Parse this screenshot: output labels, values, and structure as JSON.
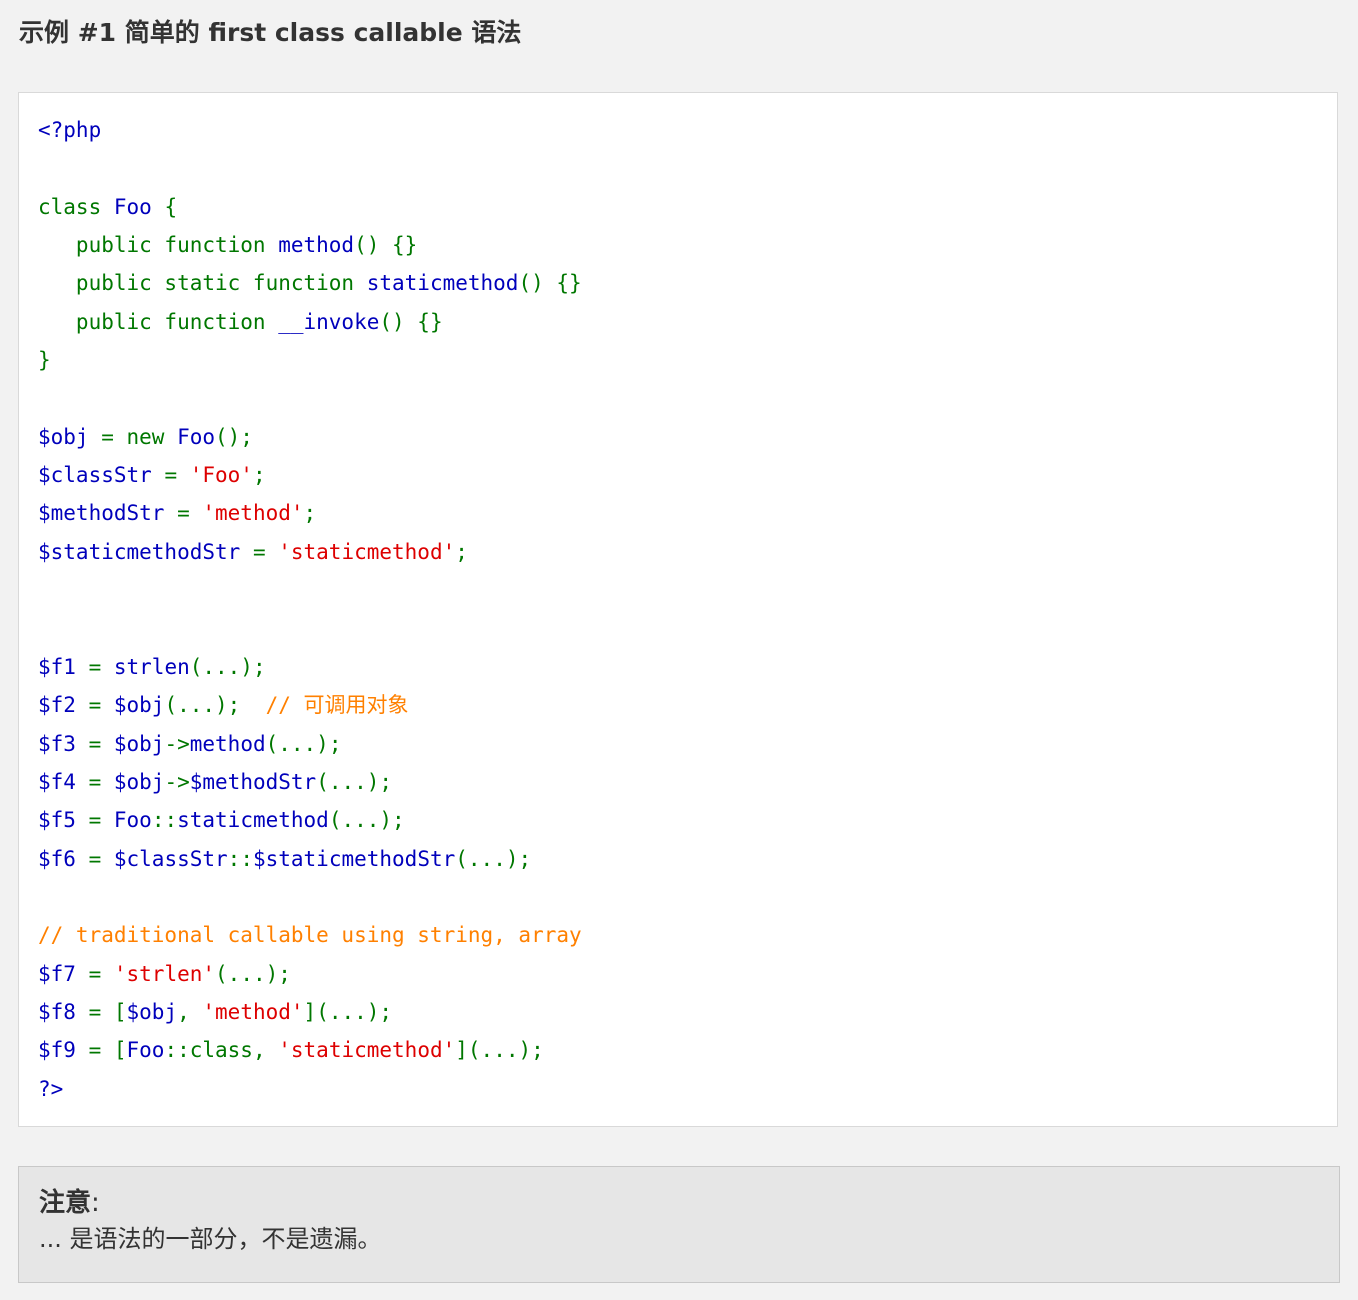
{
  "example": {
    "title": "示例 #1 简单的 first class callable 语法"
  },
  "code": {
    "colors": {
      "b": "#0000bb",
      "g": "#007700",
      "r": "#dd0000",
      "o": "#ff8000"
    },
    "lines": [
      [
        [
          "b",
          "<?php"
        ]
      ],
      [],
      [
        [
          "g",
          "class "
        ],
        [
          "b",
          "Foo "
        ],
        [
          "g",
          "{"
        ]
      ],
      [
        [
          "g",
          "   public function "
        ],
        [
          "b",
          "method"
        ],
        [
          "g",
          "() {}"
        ]
      ],
      [
        [
          "g",
          "   public static function "
        ],
        [
          "b",
          "staticmethod"
        ],
        [
          "g",
          "() {}"
        ]
      ],
      [
        [
          "g",
          "   public function "
        ],
        [
          "b",
          "__invoke"
        ],
        [
          "g",
          "() {}"
        ]
      ],
      [
        [
          "g",
          "}"
        ]
      ],
      [],
      [
        [
          "b",
          "$obj "
        ],
        [
          "g",
          "= new "
        ],
        [
          "b",
          "Foo"
        ],
        [
          "g",
          "();"
        ]
      ],
      [
        [
          "b",
          "$classStr "
        ],
        [
          "g",
          "= "
        ],
        [
          "r",
          "'Foo'"
        ],
        [
          "g",
          ";"
        ]
      ],
      [
        [
          "b",
          "$methodStr "
        ],
        [
          "g",
          "= "
        ],
        [
          "r",
          "'method'"
        ],
        [
          "g",
          ";"
        ]
      ],
      [
        [
          "b",
          "$staticmethodStr "
        ],
        [
          "g",
          "= "
        ],
        [
          "r",
          "'staticmethod'"
        ],
        [
          "g",
          ";"
        ]
      ],
      [],
      [],
      [
        [
          "b",
          "$f1 "
        ],
        [
          "g",
          "= "
        ],
        [
          "b",
          "strlen"
        ],
        [
          "g",
          "(...);"
        ]
      ],
      [
        [
          "b",
          "$f2 "
        ],
        [
          "g",
          "= "
        ],
        [
          "b",
          "$obj"
        ],
        [
          "g",
          "(...);  "
        ],
        [
          "o",
          "// 可调用对象"
        ]
      ],
      [
        [
          "b",
          "$f3 "
        ],
        [
          "g",
          "= "
        ],
        [
          "b",
          "$obj"
        ],
        [
          "g",
          "->"
        ],
        [
          "b",
          "method"
        ],
        [
          "g",
          "(...);"
        ]
      ],
      [
        [
          "b",
          "$f4 "
        ],
        [
          "g",
          "= "
        ],
        [
          "b",
          "$obj"
        ],
        [
          "g",
          "->"
        ],
        [
          "b",
          "$methodStr"
        ],
        [
          "g",
          "(...);"
        ]
      ],
      [
        [
          "b",
          "$f5 "
        ],
        [
          "g",
          "= "
        ],
        [
          "b",
          "Foo"
        ],
        [
          "g",
          "::"
        ],
        [
          "b",
          "staticmethod"
        ],
        [
          "g",
          "(...);"
        ]
      ],
      [
        [
          "b",
          "$f6 "
        ],
        [
          "g",
          "= "
        ],
        [
          "b",
          "$classStr"
        ],
        [
          "g",
          "::"
        ],
        [
          "b",
          "$staticmethodStr"
        ],
        [
          "g",
          "(...);"
        ]
      ],
      [],
      [
        [
          "o",
          "// traditional callable using string, array"
        ]
      ],
      [
        [
          "b",
          "$f7 "
        ],
        [
          "g",
          "= "
        ],
        [
          "r",
          "'strlen'"
        ],
        [
          "g",
          "(...);"
        ]
      ],
      [
        [
          "b",
          "$f8 "
        ],
        [
          "g",
          "= ["
        ],
        [
          "b",
          "$obj"
        ],
        [
          "g",
          ", "
        ],
        [
          "r",
          "'method'"
        ],
        [
          "g",
          "](...);"
        ]
      ],
      [
        [
          "b",
          "$f9 "
        ],
        [
          "g",
          "= ["
        ],
        [
          "b",
          "Foo"
        ],
        [
          "g",
          "::class, "
        ],
        [
          "r",
          "'staticmethod'"
        ],
        [
          "g",
          "](...);"
        ]
      ],
      [
        [
          "b",
          "?>"
        ]
      ]
    ]
  },
  "note": {
    "title": "注意",
    "colon": ":",
    "body": "... 是语法的一部分，不是遗漏。"
  }
}
